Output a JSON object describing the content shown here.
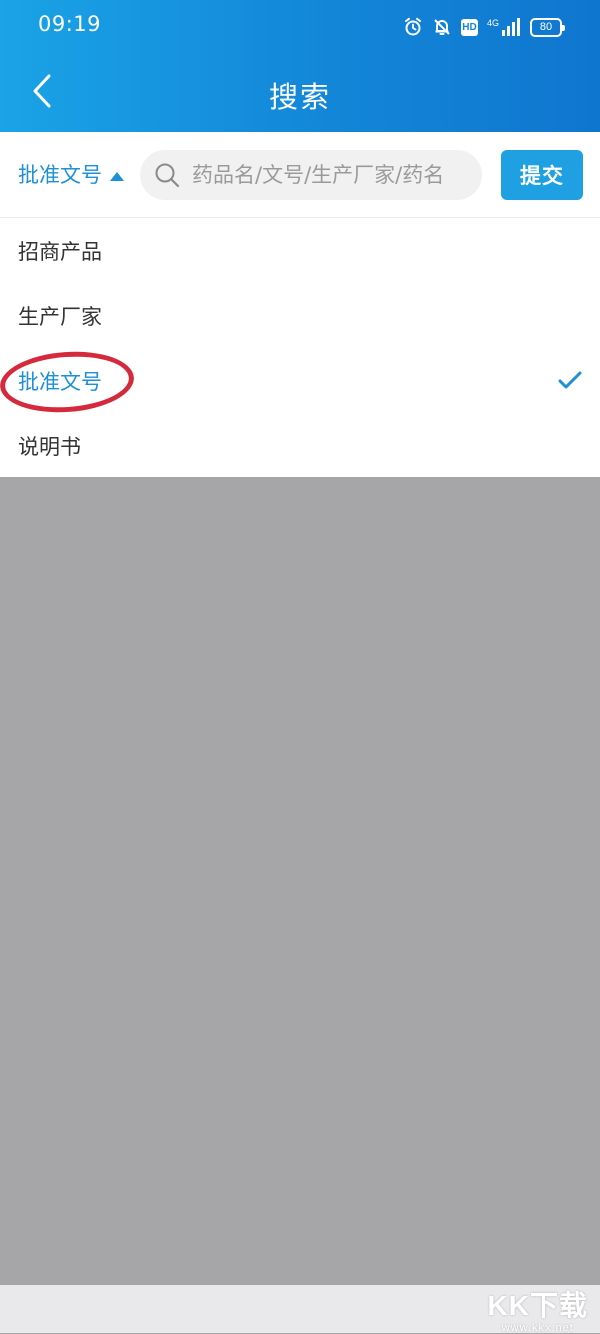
{
  "status_bar": {
    "time": "09:19",
    "icons": [
      "alarm-icon",
      "bell-off-icon",
      "hd-icon",
      "4g-signal-icon",
      "battery-icon"
    ],
    "hd_label": "HD",
    "network_label": "4G",
    "battery_level": "80"
  },
  "header": {
    "back_icon": "chevron-left-icon",
    "title": "搜索"
  },
  "search": {
    "type_label": "批准文号",
    "type_icon": "caret-up-icon",
    "placeholder": "药品名/文号/生产厂家/药名",
    "value": "",
    "submit_label": "提交"
  },
  "dropdown": {
    "items": [
      {
        "label": "招商产品",
        "selected": false
      },
      {
        "label": "生产厂家",
        "selected": false
      },
      {
        "label": "批准文号",
        "selected": true
      },
      {
        "label": "说明书",
        "selected": false
      }
    ]
  },
  "colors": {
    "header_start": "#1aa3e6",
    "header_end": "#0f76cf",
    "accent": "#1f8fd6",
    "submit_bg": "#1ea0e3",
    "overlay": "#a6a6a8",
    "annotation": "#d42a3c"
  },
  "watermark": {
    "logo": "KK下载",
    "url": "www.kkx.net"
  }
}
